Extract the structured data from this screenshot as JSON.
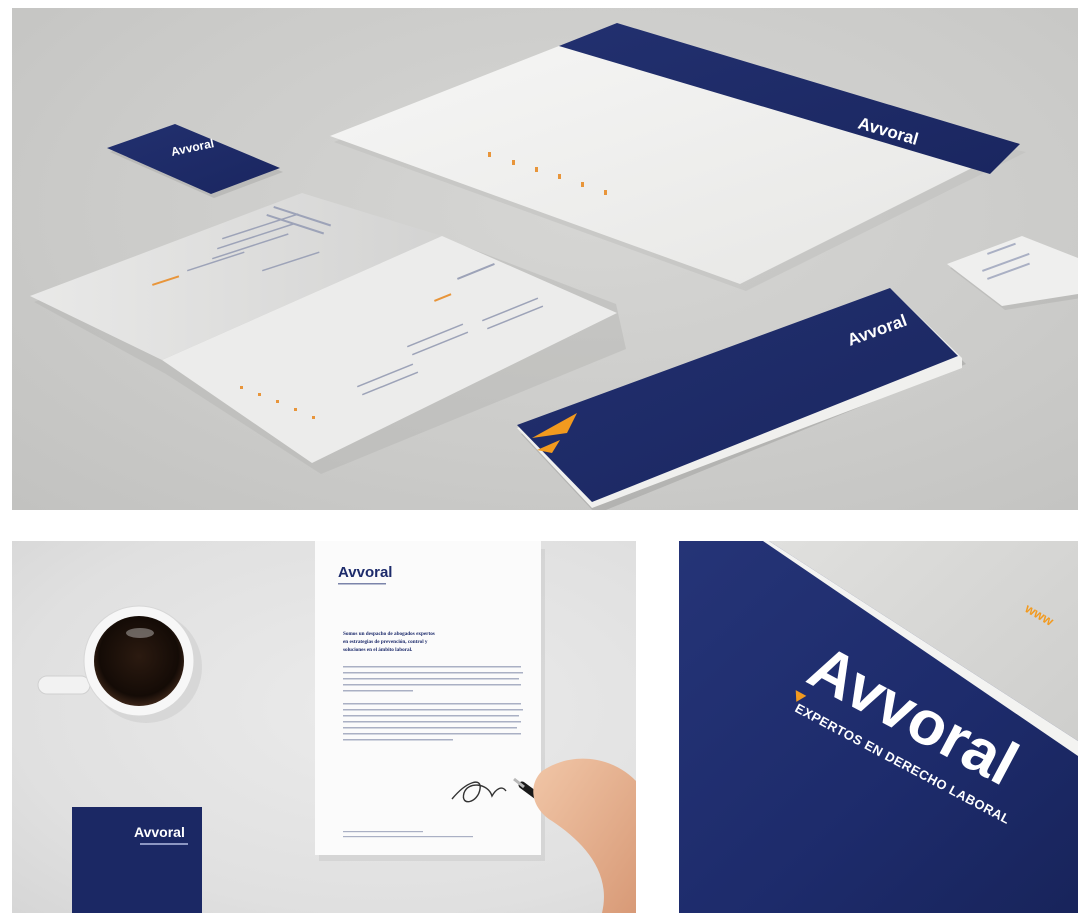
{
  "brand": {
    "name": "Avvoral",
    "tagline": "EXPERTOS EN DERECHO LABORAL",
    "colors": {
      "navy": "#1d2b6b",
      "orange": "#f29a1f",
      "paper": "#f4f4f2"
    }
  },
  "letter": {
    "heading": [
      "Somos un despacho de abogados expertos",
      "en estrategias de prevención, control y",
      "soluciones en el ámbito laboral."
    ]
  },
  "panels": [
    "stationery-overview",
    "letterhead-with-coffee",
    "folder-closeup"
  ]
}
